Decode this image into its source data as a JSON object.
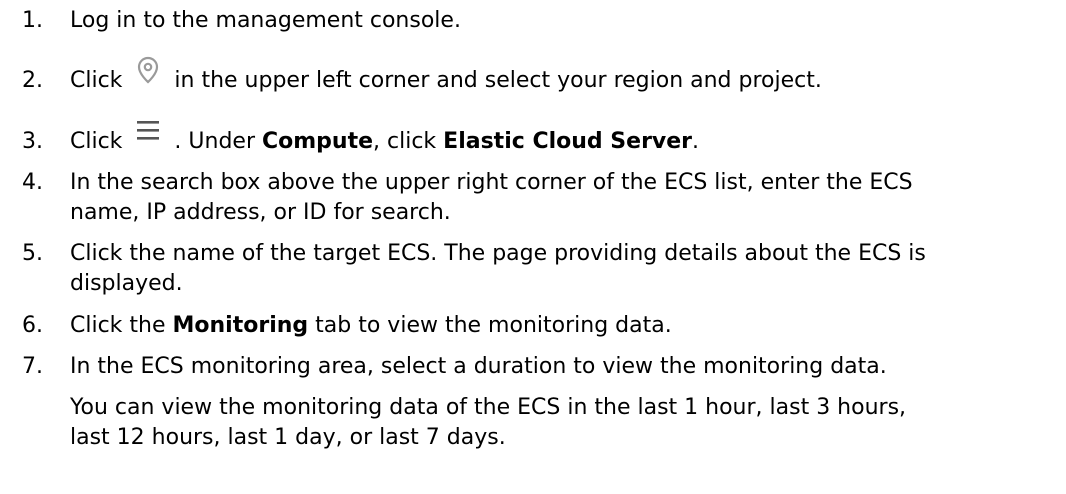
{
  "steps": [
    {
      "num": "1.",
      "text": "Log in to the management console."
    },
    {
      "num": "2.",
      "pre": "Click ",
      "icon": "location-pin-icon",
      "post": " in the upper left corner and select your region and project."
    },
    {
      "num": "3.",
      "pre": "Click ",
      "icon": "menu-icon",
      "mid": " . Under ",
      "bold1": "Compute",
      "mid2": ", click ",
      "bold2": "Elastic Cloud Server",
      "post": "."
    },
    {
      "num": "4.",
      "line1": "In the search box above the upper right corner of the ECS list, enter the ECS",
      "line2": "name, IP address, or ID for search."
    },
    {
      "num": "5.",
      "line1": "Click the name of the target ECS. The page providing details about the ECS is",
      "line2": "displayed."
    },
    {
      "num": "6.",
      "pre": "Click the ",
      "bold1": "Monitoring",
      "post": " tab to view the monitoring data."
    },
    {
      "num": "7.",
      "text": "In the ECS monitoring area, select a duration to view the monitoring data.",
      "note1": "You can view the monitoring data of the ECS in the last 1 hour, last 3 hours,",
      "note2": "last 12 hours, last 1 day, or last 7 days."
    }
  ],
  "colors": {
    "text": "#000000",
    "icon": "#9a9a9a",
    "background": "#ffffff"
  }
}
